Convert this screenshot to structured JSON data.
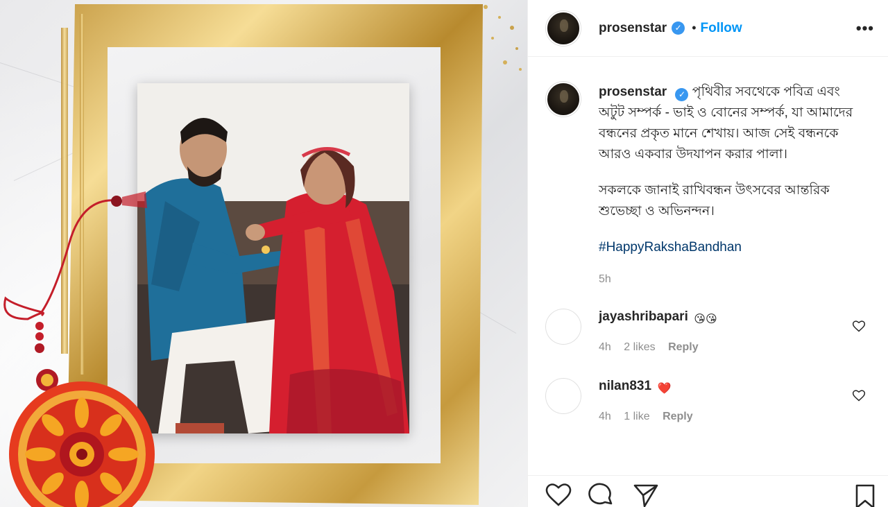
{
  "post": {
    "username": "prosenstar",
    "follow_label": "Follow",
    "more_label": "•••",
    "dot": "•",
    "verified_mark": "✓"
  },
  "caption": {
    "username": "prosenstar",
    "para1": "পৃথিবীর সবথেকে পবিত্র এবং অটুট সম্পর্ক - ভাই ও বোনের সম্পর্ক, যা আমাদের বন্ধনের প্রকৃত মানে শেখায়। আজ সেই বন্ধনকে আরও একবার উদযাপন করার পালা।",
    "para2": "সকলকে জানাই রাখিবন্ধন উৎসবের আন্তরিক শুভেচ্ছা ও অভিনন্দন।",
    "hashtag": "#HappyRakshaBandhan",
    "time": "5h"
  },
  "comments": [
    {
      "username": "jayashribapari",
      "emoji": "😘😘",
      "time": "4h",
      "likes": "2 likes",
      "reply": "Reply"
    },
    {
      "username": "nilan831",
      "emoji": "❤️",
      "time": "4h",
      "likes": "1 like",
      "reply": "Reply"
    }
  ],
  "colors": {
    "link_blue": "#0095f6",
    "hashtag": "#00376b",
    "meta_gray": "#8e8e8e",
    "verified": "#3897f0"
  },
  "icons": [
    "verified-badge-icon",
    "more-options-icon",
    "heart-icon",
    "comment-icon",
    "share-icon",
    "save-icon"
  ]
}
